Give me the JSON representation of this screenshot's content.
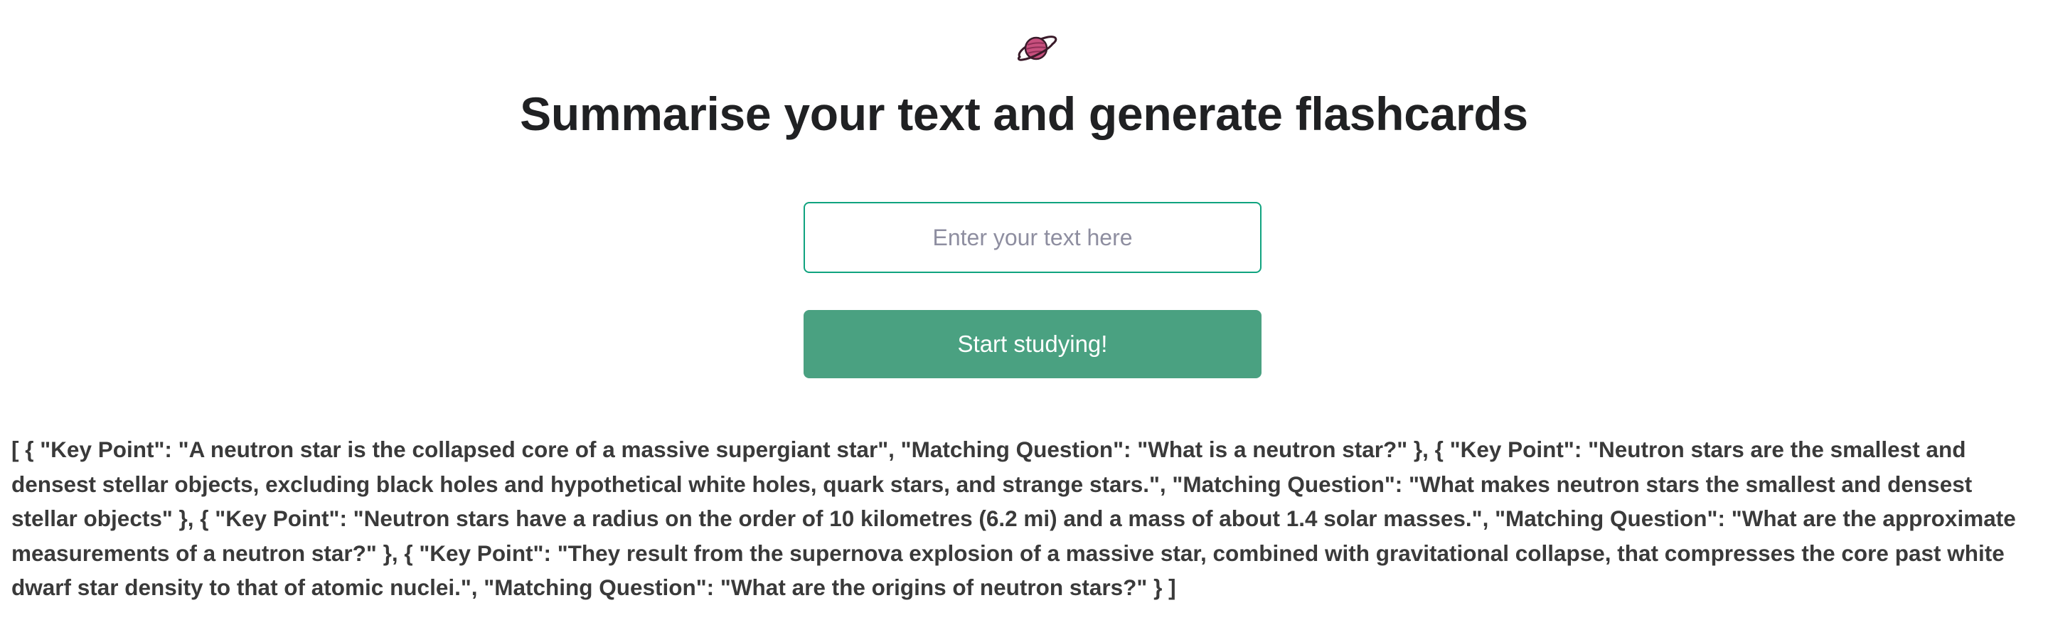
{
  "header": {
    "logo_icon": "ringed-planet-icon",
    "title": "Summarise your text and generate flashcards"
  },
  "form": {
    "input_placeholder": "Enter your text here",
    "input_value": "",
    "submit_label": "Start studying!"
  },
  "output": {
    "result_text": "[ { \"Key Point\": \"A neutron star is the collapsed core of a massive supergiant star\", \"Matching Question\": \"What is a neutron star?\" }, { \"Key Point\": \"Neutron stars are the smallest and densest stellar objects, excluding black holes and hypothetical white holes, quark stars, and strange stars.\", \"Matching Question\": \"What makes neutron stars the smallest and densest stellar objects\" }, { \"Key Point\": \"Neutron stars have a radius on the order of 10 kilometres (6.2 mi) and a mass of about 1.4 solar masses.\", \"Matching Question\": \"What are the approximate measurements of a neutron star?\" }, { \"Key Point\": \"They result from the supernova explosion of a massive star, combined with gravitational collapse, that compresses the core past white dwarf star density to that of atomic nuclei.\", \"Matching Question\": \"What are the origins of neutron stars?\" } ]"
  },
  "colors": {
    "accent_border": "#10a37f",
    "button_bg": "#4aa181",
    "button_text": "#ffffff",
    "planet_fill": "#c8507e",
    "planet_outline": "#3a1b2a"
  }
}
